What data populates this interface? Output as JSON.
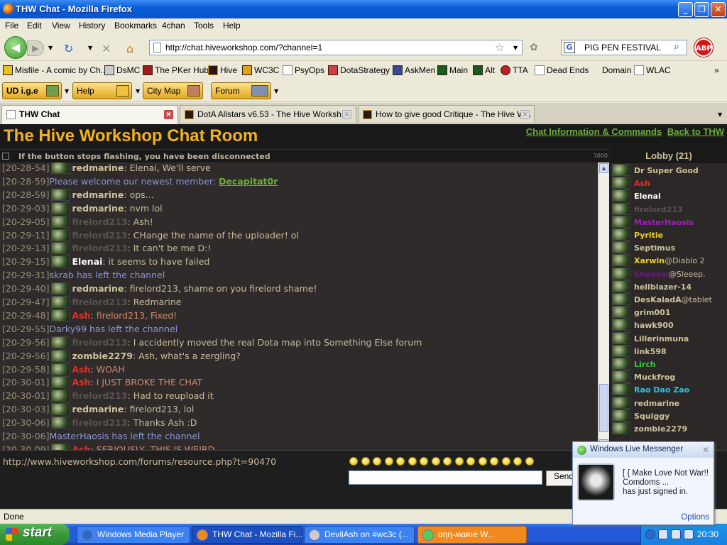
{
  "window": {
    "title": "THW Chat - Mozilla Firefox"
  },
  "menu": [
    "File",
    "Edit",
    "View",
    "History",
    "Bookmarks",
    "4chan",
    "Tools",
    "Help"
  ],
  "nav": {
    "url": "http://chat.hiveworkshop.com/?channel=1",
    "search": "PIG PEN FESTIVAL",
    "abp": "ABP"
  },
  "bookmarks": [
    "Misfile - A comic by Ch...",
    "DsMC",
    "The PKer Hub",
    "Hive",
    "WC3C",
    "PsyOps",
    "DotaStrategy",
    "AskMen",
    "Main",
    "Alt",
    "TTA",
    "Dead Ends",
    "Domain",
    "WLAC"
  ],
  "toolbar": {
    "btn1": "UD i.g.e",
    "btn2": "Help",
    "btn3": "City Map",
    "btn4": "Forum"
  },
  "tabs": [
    "THW Chat",
    "DotA Allstars v6.53 - The Hive Worksh...",
    "How to give good Critique - The Hive W..."
  ],
  "page": {
    "title": "The Hive Workshop Chat Room",
    "link1": "Chat Information & Commands",
    "link2": "Back to THW",
    "notice": "If the button stops flashing, you have been disconnected",
    "counter": "3000",
    "lobby_title": "Lobby (21)",
    "input_link": "http://www.hiveworkshop.com/forums/resource.php?t=90470",
    "send": "Send"
  },
  "chat": [
    {
      "ts": "[20-28-54]",
      "name": "redmarine",
      "text": " Elenai, We'll serve",
      "color": "#cfc39a"
    },
    {
      "ts": "[20-28-59]",
      "sys": "Please welcome our newest member: ",
      "link": "Decapitat0r"
    },
    {
      "ts": "[20-28-59]",
      "name": "redmarine",
      "text": " ops...",
      "color": "#cfc39a"
    },
    {
      "ts": "[20-29-03]",
      "name": "redmarine",
      "text": " nvm lol",
      "color": "#cfc39a"
    },
    {
      "ts": "[20-29-05]",
      "name": "firelord213",
      "text": " Ash!",
      "color": "#5a5450"
    },
    {
      "ts": "[20-29-11]",
      "name": "firelord213",
      "text": " CHange the name of the uploader! ol",
      "color": "#5a5450"
    },
    {
      "ts": "[20-29-13]",
      "name": "firelord213",
      "text": " It can't be me D:!",
      "color": "#5a5450"
    },
    {
      "ts": "[20-29-15]",
      "name": "Elenai",
      "text": " it seems to have failed",
      "color": "#ffffff"
    },
    {
      "ts": "[20-29-31]",
      "sys": "skrab has left the channel"
    },
    {
      "ts": "[20-29-40]",
      "name": "redmarine",
      "text": " firelord213, shame on you firelord shame!",
      "color": "#cfc39a"
    },
    {
      "ts": "[20-29-47]",
      "name": "firelord213",
      "text": " Redmarine",
      "color": "#5a5450"
    },
    {
      "ts": "[20-29-48]",
      "name": "Ash",
      "text": " firelord213, Fixed!",
      "color": "#e0302a"
    },
    {
      "ts": "[20-29-55]",
      "sys": "Darky99 has left the channel"
    },
    {
      "ts": "[20-29-56]",
      "name": "firelord213",
      "text": " I accidently moved the real Dota map into Something Else forum",
      "color": "#5a5450"
    },
    {
      "ts": "[20-29-56]",
      "name": "zombie2279",
      "text": " Ash, what's a zergling?",
      "color": "#cfc39a"
    },
    {
      "ts": "[20-29-58]",
      "name": "Ash",
      "text": " WOAH",
      "color": "#e0302a"
    },
    {
      "ts": "[20-30-01]",
      "name": "Ash",
      "text": " I JUST BROKE THE CHAT",
      "color": "#e0302a"
    },
    {
      "ts": "[20-30-01]",
      "name": "firelord213",
      "text": " Had to reupload it",
      "color": "#5a5450"
    },
    {
      "ts": "[20-30-03]",
      "name": "redmarine",
      "text": " firelord213, lol",
      "color": "#cfc39a"
    },
    {
      "ts": "[20-30-06]",
      "name": "firelord213",
      "text": " Thanks Ash :D",
      "color": "#5a5450"
    },
    {
      "ts": "[20-30-06]",
      "sys": "MasterHaosis has left the channel"
    },
    {
      "ts": "[20-30-09]",
      "name": "Ash",
      "text": " SERIOUSLY, THIS IS WEIRD.",
      "color": "#e0302a"
    }
  ],
  "lobby": [
    {
      "name": "Dr Super Good",
      "color": "#cfc39a"
    },
    {
      "name": "Ash",
      "color": "#e0302a"
    },
    {
      "name": "Elenai",
      "color": "#ffffff"
    },
    {
      "name": "firelord213",
      "color": "#5a5450"
    },
    {
      "name": "MasterHaosis",
      "color": "#a020c0"
    },
    {
      "name": "Pyritie",
      "color": "#f0d020"
    },
    {
      "name": "Septimus",
      "color": "#cfc39a"
    },
    {
      "name": "Xarwin",
      "color": "#f0d020",
      "status": "@Diablo 2"
    },
    {
      "name": "Shadow",
      "color": "#6a1a7a",
      "status": "@Sleeep."
    },
    {
      "name": "hellblazer-14",
      "color": "#cfc39a"
    },
    {
      "name": "DesKaladA",
      "color": "#cfc39a",
      "status": "@tablet"
    },
    {
      "name": "grim001",
      "color": "#cfc39a"
    },
    {
      "name": "hawk900",
      "color": "#cfc39a"
    },
    {
      "name": "Lillerinmuna",
      "color": "#cfc39a"
    },
    {
      "name": "link598",
      "color": "#cfc39a"
    },
    {
      "name": "Lirch",
      "color": "#30d030"
    },
    {
      "name": "Muckfrog",
      "color": "#cfc39a"
    },
    {
      "name": "Rao Dao Zao",
      "color": "#30c0e0"
    },
    {
      "name": "redmarine",
      "color": "#cfc39a"
    },
    {
      "name": "Squiggy",
      "color": "#cfc39a"
    },
    {
      "name": "zombie2279",
      "color": "#cfc39a"
    }
  ],
  "status": "Done",
  "taskbar": {
    "start": "start",
    "tasks": [
      "Windows Media Player",
      "THW Chat - Mozilla Fi...",
      "DevilAsh on #wc3c (...",
      "ɑηη-ʍɑʀıe     W..."
    ],
    "clock": "20:30"
  },
  "popup": {
    "title": "Windows Live Messenger",
    "line1": "[ { Make Love Not War!!",
    "line2": "Comdoms ...",
    "line3": "has just signed in.",
    "options": "Options"
  }
}
